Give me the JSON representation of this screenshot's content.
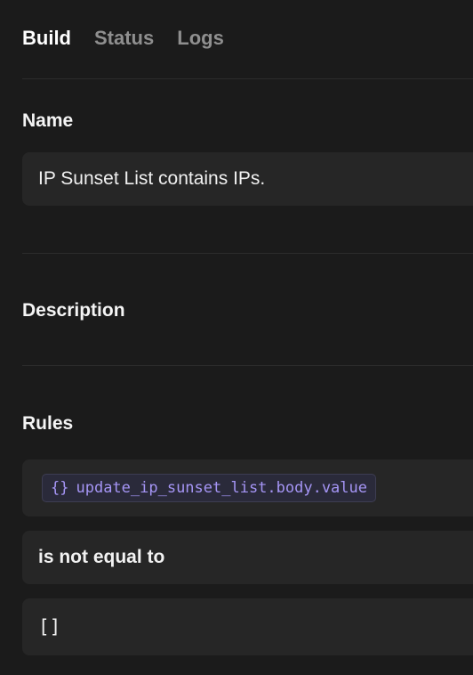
{
  "tabs": [
    {
      "label": "Build",
      "active": true
    },
    {
      "label": "Status",
      "active": false
    },
    {
      "label": "Logs",
      "active": false
    }
  ],
  "sections": {
    "name": {
      "label": "Name",
      "value": "IP Sunset List contains IPs."
    },
    "description": {
      "label": "Description"
    },
    "rules": {
      "label": "Rules",
      "variable": "update_ip_sunset_list.body.value",
      "variable_icon": "{}",
      "operator": "is not equal to",
      "value": "[]"
    }
  },
  "colors": {
    "background": "#1b1b1b",
    "field": "#262626",
    "variable_accent": "#a595f5",
    "inactive_tab": "#8f8f8f"
  }
}
